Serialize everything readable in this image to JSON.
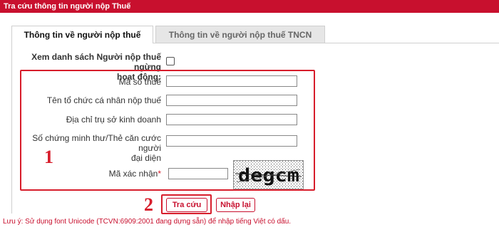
{
  "titlebar": {
    "title": "Tra cứu thông tin người nộp Thuế"
  },
  "tabs": [
    {
      "label": "Thông tin về người nộp thuế",
      "active": true
    },
    {
      "label": "Thông tin về người nộp thuế TNCN",
      "active": false
    }
  ],
  "form": {
    "inactive_list_label_line1": "Xem danh sách Người nộp thuế ngừng",
    "inactive_list_label_line2": "hoạt động:",
    "inactive_list_checked": false,
    "tax_code_label": "Mã số thuế",
    "tax_code_value": "",
    "name_label": "Tên tổ chức cá nhân nộp thuế",
    "name_value": "",
    "address_label": "Địa chỉ trụ sở kinh doanh",
    "address_value": "",
    "id_label_line1": "Số chứng minh thư/Thẻ căn cước người",
    "id_label_line2": "đại diện",
    "id_value": "",
    "captcha_label": "Mã xác nhận",
    "captcha_required_mark": "*",
    "captcha_value": "",
    "captcha_image_text": "degcm"
  },
  "annotations": {
    "marker_1": "1",
    "marker_2": "2"
  },
  "buttons": {
    "search_label": "Tra cứu",
    "reset_label": "Nhập lại"
  },
  "note": "Lưu ý: Sử dụng font Unicode (TCVN:6909:2001 đang dựng sẵn) để nhập tiếng Việt có dấu.",
  "colors": {
    "brand_red": "#c8102e",
    "annotation_red": "#d71d2b"
  }
}
